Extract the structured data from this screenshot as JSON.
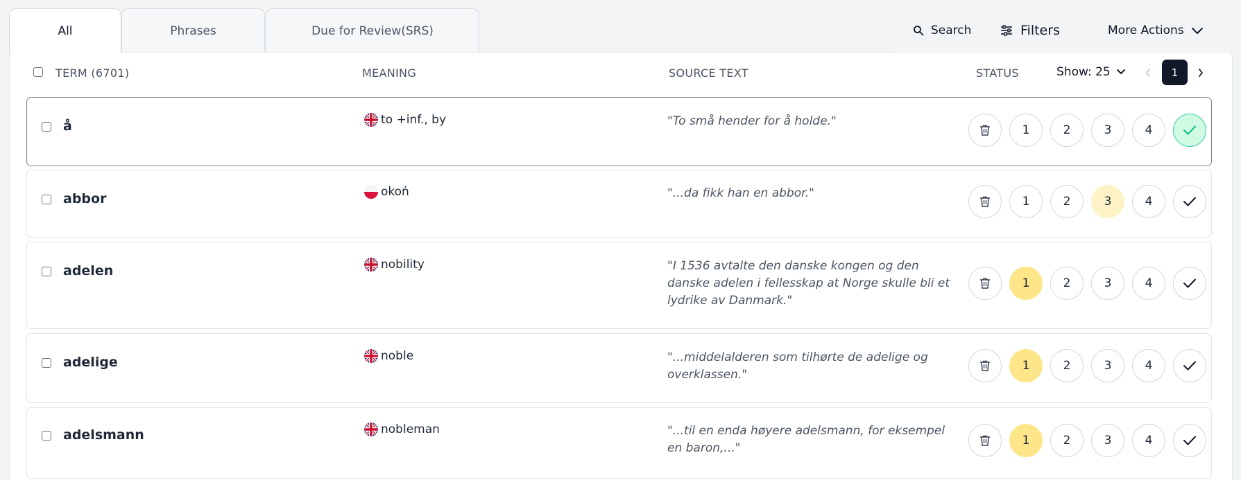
{
  "tabs": [
    {
      "label": "All"
    },
    {
      "label": "Phrases"
    },
    {
      "label": "Due for Review(SRS)"
    }
  ],
  "actions": {
    "search": "Search",
    "filters": "Filters",
    "more": "More Actions"
  },
  "header": {
    "term": "TERM (6701)",
    "meaning": "MEANING",
    "source": "SOURCE TEXT",
    "status": "STATUS",
    "show": "Show: 25",
    "page": "1"
  },
  "rows": [
    {
      "term": "å",
      "flag": "uk",
      "meaning": "to +inf., by",
      "source": "To små hender for å holde.",
      "level": "known"
    },
    {
      "term": "abbor",
      "flag": "pl",
      "meaning": "okoń",
      "source": "...da fikk han en abbor.",
      "level": "3"
    },
    {
      "term": "adelen",
      "flag": "uk",
      "meaning": "nobility",
      "source": "I 1536 avtalte den danske kongen og den danske adelen i fellesskap at Norge skulle bli et lydrike av Danmark.",
      "level": "1"
    },
    {
      "term": "adelige",
      "flag": "uk",
      "meaning": "noble",
      "source": "...middelalderen som tilhørte de adelige og overklassen.",
      "level": "1"
    },
    {
      "term": "adelsmann",
      "flag": "uk",
      "meaning": "nobleman",
      "source": "...til en enda høyere adelsmann, for eksempel en baron,...",
      "level": "1"
    }
  ],
  "status_labels": [
    "1",
    "2",
    "3",
    "4"
  ],
  "colors": {
    "level_1": "#fde68a",
    "level_3": "#fef3c7",
    "known": "#d1fae5",
    "page_active": "#111827"
  }
}
